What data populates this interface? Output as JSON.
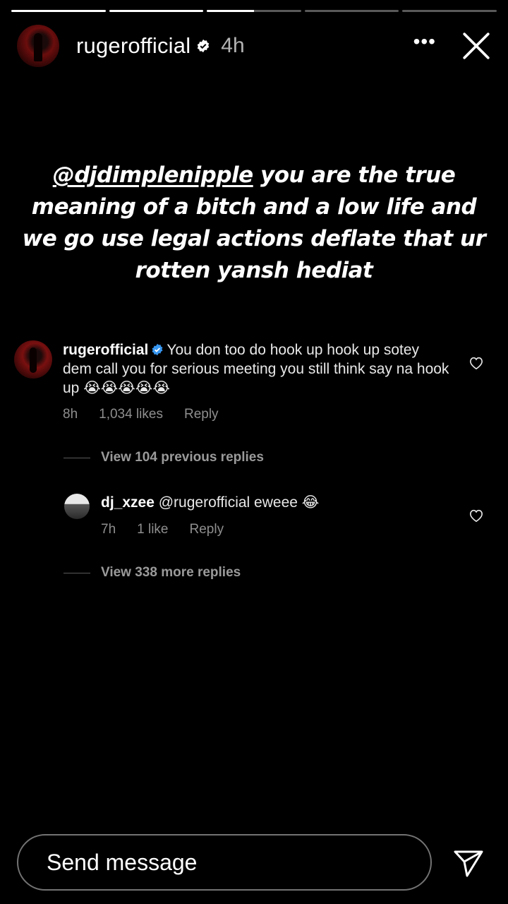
{
  "story": {
    "progress": [
      1,
      1,
      0.5,
      0,
      0
    ],
    "username": "rugerofficial",
    "time": "4h",
    "more_icon": "more-horizontal-icon",
    "close_icon": "close-icon",
    "text_mention": "@djdimplenipple",
    "text_body": " you are the true meaning of a bitch and a low life and we go use legal actions deflate that ur rotten yansh hediat"
  },
  "comment": {
    "username": "rugerofficial",
    "text": "You don too do hook up hook up sotey dem call you for serious meeting you still think say na hook up 😭😭😭😭😭",
    "time": "8h",
    "likes": "1,034 likes",
    "reply_label": "Reply"
  },
  "view_previous": "View 104 previous replies",
  "reply": {
    "username": "dj_xzee",
    "text": "@rugerofficial eweee 😂",
    "time": "7h",
    "likes": "1 like",
    "reply_label": "Reply"
  },
  "view_more": "View 338 more replies",
  "composer": {
    "placeholder": "Send message"
  },
  "colors": {
    "background": "#000000",
    "verified": "#3897f0",
    "muted": "#8e8e8e"
  }
}
